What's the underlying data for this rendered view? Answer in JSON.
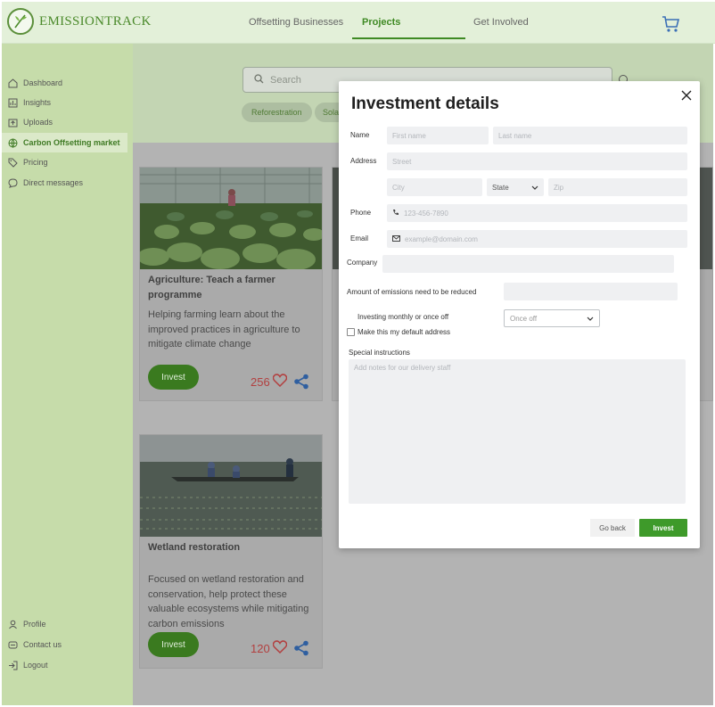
{
  "header": {
    "brand": "EMISSIONTRACK",
    "nav": [
      "Offsetting Businesses",
      "Projects",
      "Get Involved"
    ],
    "active_nav": "Projects",
    "cart_icon": "cart-icon"
  },
  "sidebar": {
    "items": [
      {
        "label": "Dashboard",
        "icon": "home-icon"
      },
      {
        "label": "Insights",
        "icon": "chart-icon"
      },
      {
        "label": "Uploads",
        "icon": "upload-icon"
      },
      {
        "label": "Carbon Offsetting market",
        "icon": "globe-icon",
        "active": true
      },
      {
        "label": "Pricing",
        "icon": "tag-icon"
      },
      {
        "label": "Direct messages",
        "icon": "chat-icon"
      }
    ],
    "bottom": [
      {
        "label": "Profile",
        "icon": "user-icon"
      },
      {
        "label": "Contact us",
        "icon": "phone-icon"
      },
      {
        "label": "Logout",
        "icon": "logout-icon"
      }
    ]
  },
  "main": {
    "search_placeholder": "Search",
    "chips": [
      "Reforestration",
      "Sola"
    ]
  },
  "cards": [
    {
      "title": "Agriculture: Teach a farmer programme",
      "description": "Helping farming learn about the improved practices in agriculture to mitigate climate change",
      "invest_label": "Invest",
      "likes": "256"
    },
    {
      "title": "Wetland restoration",
      "description": "Focused on wetland restoration and conservation, help protect these valuable ecosystems while mitigating carbon emissions",
      "invest_label": "Invest",
      "likes": "120"
    }
  ],
  "modal": {
    "title": "Investment details",
    "labels": {
      "name": "Name",
      "address": "Address",
      "phone": "Phone",
      "email": "Email",
      "company": "Company",
      "emissions": "Amount of emissions need to be reduced",
      "frequency": "Investing monthly or once off",
      "default_address": "Make this my default address",
      "instructions": "Special instructions"
    },
    "placeholders": {
      "first_name": "First name",
      "last_name": "Last name",
      "street": "Street",
      "city": "City",
      "zip": "Zip",
      "phone": "123-456-7890",
      "email": "example@domain.com",
      "notes": "Add notes for our delivery staff"
    },
    "state_select": "State",
    "frequency_select": "Once off",
    "go_back": "Go back",
    "invest": "Invest"
  }
}
